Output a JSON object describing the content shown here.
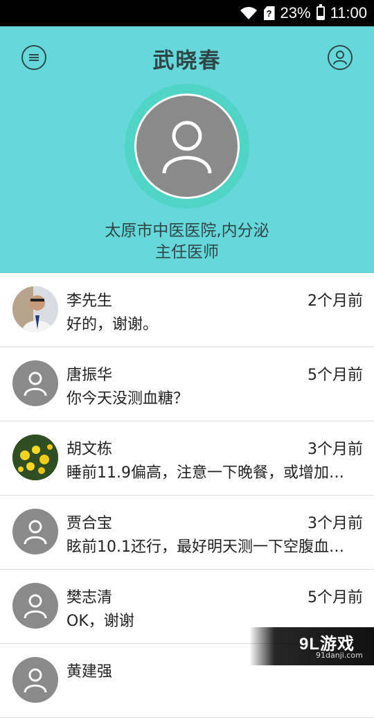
{
  "status_bar": {
    "battery": "23%",
    "time": "11:00",
    "icons": [
      "wifi-icon",
      "sim-unknown-icon",
      "battery-icon"
    ]
  },
  "header": {
    "title": "武晓春",
    "hospital": "太原市中医医院,内分泌",
    "position": "主任医师",
    "menu_icon": "menu-icon",
    "profile_icon": "user-profile-icon",
    "colors": {
      "background": "#66d8dc",
      "ring": "#4fd4c6",
      "text": "#2e4646"
    }
  },
  "conversations": [
    {
      "name": "李先生",
      "time": "2个月前",
      "message": "好的，谢谢。",
      "avatar": "photo-man"
    },
    {
      "name": "唐振华",
      "time": "5个月前",
      "message": "你今天没测血糖？",
      "avatar": "default"
    },
    {
      "name": "胡文栋",
      "time": "3个月前",
      "message": "睡前11.9偏高，注意一下晚餐，或增加…",
      "avatar": "photo-flowers"
    },
    {
      "name": "贾合宝",
      "time": "3个月前",
      "message": "眩前10.1还行，最好明天测一下空腹血…",
      "avatar": "default"
    },
    {
      "name": "樊志清",
      "time": "5个月前",
      "message": "OK，谢谢",
      "avatar": "default"
    },
    {
      "name": "黄建强",
      "time": "",
      "message": "",
      "avatar": "default"
    }
  ],
  "watermark": {
    "logo": "9L游戏",
    "site": "91danji.com"
  }
}
